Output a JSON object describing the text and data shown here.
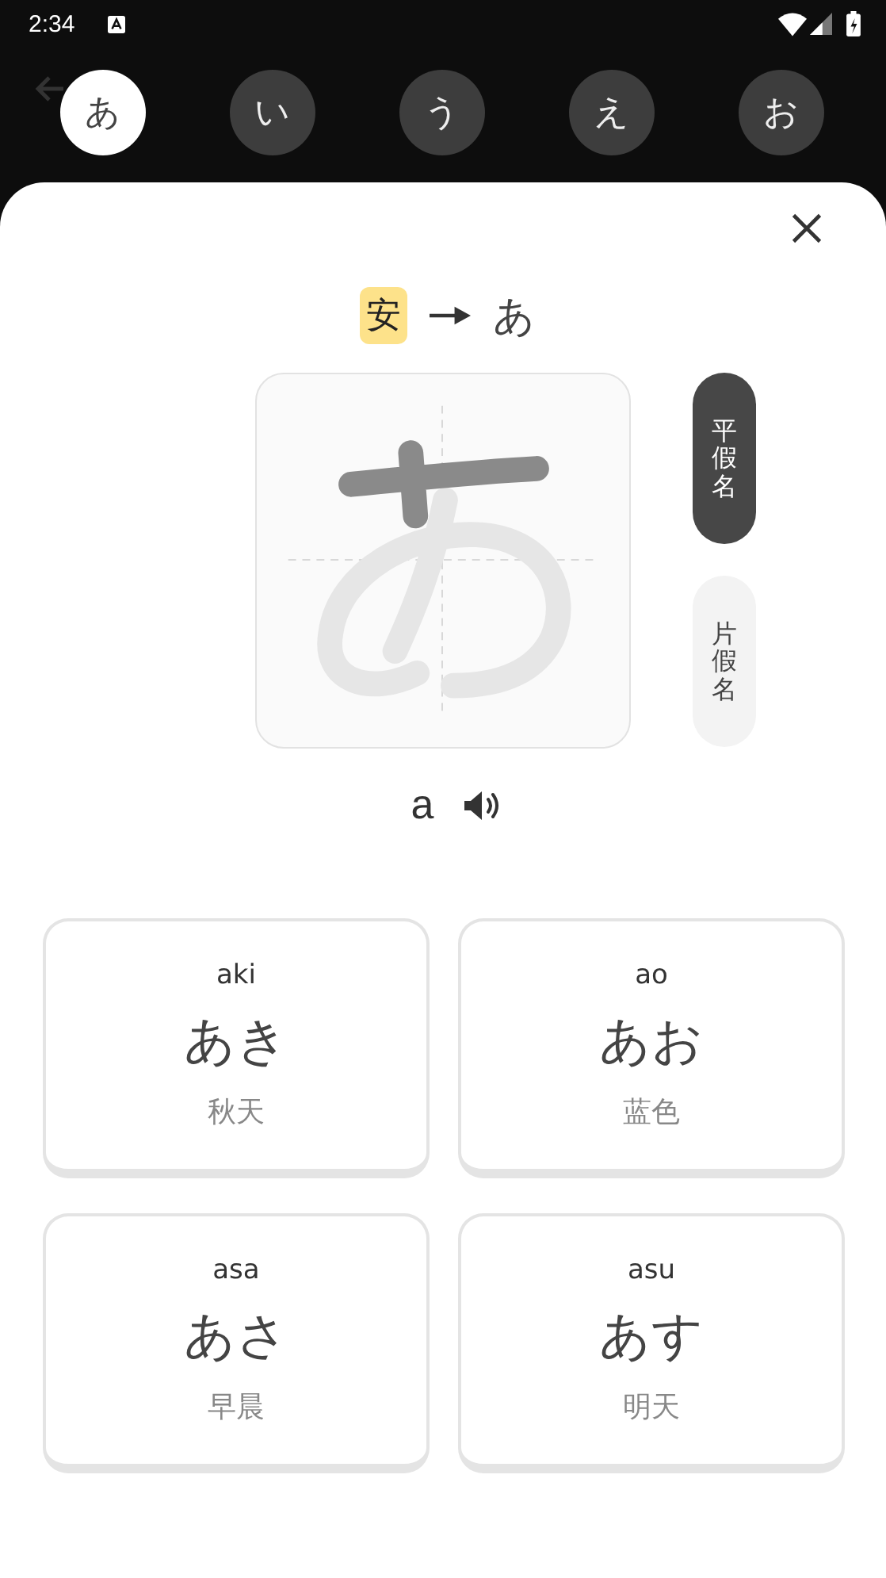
{
  "status_bar": {
    "time": "2:34"
  },
  "kana_tabs": [
    {
      "label": "あ",
      "selected": true
    },
    {
      "label": "い",
      "selected": false
    },
    {
      "label": "う",
      "selected": false
    },
    {
      "label": "え",
      "selected": false
    },
    {
      "label": "お",
      "selected": false
    }
  ],
  "origin": {
    "kanji": "安",
    "kana": "あ"
  },
  "script_tabs": [
    {
      "label": "平假名",
      "selected": true
    },
    {
      "label": "片假名",
      "selected": false
    }
  ],
  "romaji": "a",
  "words": [
    {
      "romaji": "aki",
      "kana": "あき",
      "meaning": "秋天"
    },
    {
      "romaji": "ao",
      "kana": "あお",
      "meaning": "蓝色"
    },
    {
      "romaji": "asa",
      "kana": "あさ",
      "meaning": "早晨"
    },
    {
      "romaji": "asu",
      "kana": "あす",
      "meaning": "明天"
    }
  ]
}
